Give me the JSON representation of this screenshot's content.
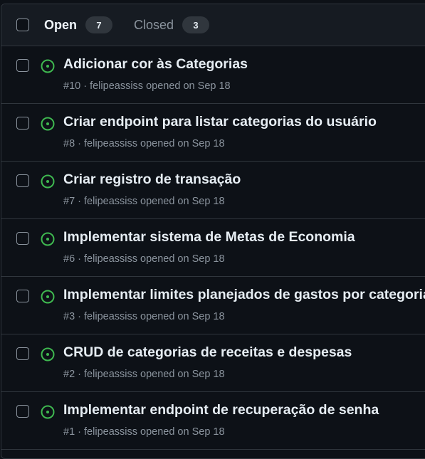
{
  "header": {
    "open_label": "Open",
    "open_count": "7",
    "closed_label": "Closed",
    "closed_count": "3"
  },
  "colors": {
    "background": "#0d1117",
    "header_bg": "#161b22",
    "border": "#30363d",
    "open_icon": "#3fb950",
    "muted_text": "#8b949e",
    "title_text": "#e6edf3"
  },
  "issues": [
    {
      "title": "Adicionar cor às Categorias",
      "number": "#10",
      "author": "felipeassiss",
      "opened": "opened on Sep 18",
      "status_icon": "issue-opened-icon"
    },
    {
      "title": "Criar endpoint para listar categorias do usuário",
      "number": "#8",
      "author": "felipeassiss",
      "opened": "opened on Sep 18",
      "status_icon": "issue-opened-icon"
    },
    {
      "title": "Criar registro de transação",
      "number": "#7",
      "author": "felipeassiss",
      "opened": "opened on Sep 18",
      "status_icon": "issue-opened-icon"
    },
    {
      "title": "Implementar sistema de Metas de Economia",
      "number": "#6",
      "author": "felipeassiss",
      "opened": "opened on Sep 18",
      "status_icon": "issue-opened-icon"
    },
    {
      "title": "Implementar limites planejados de gastos por categoria",
      "number": "#3",
      "author": "felipeassiss",
      "opened": "opened on Sep 18",
      "status_icon": "issue-opened-icon"
    },
    {
      "title": "CRUD de categorias de receitas e despesas",
      "number": "#2",
      "author": "felipeassiss",
      "opened": "opened on Sep 18",
      "status_icon": "issue-opened-icon"
    },
    {
      "title": "Implementar endpoint de recuperação de senha",
      "number": "#1",
      "author": "felipeassiss",
      "opened": "opened on Sep 18",
      "status_icon": "issue-opened-icon"
    }
  ]
}
